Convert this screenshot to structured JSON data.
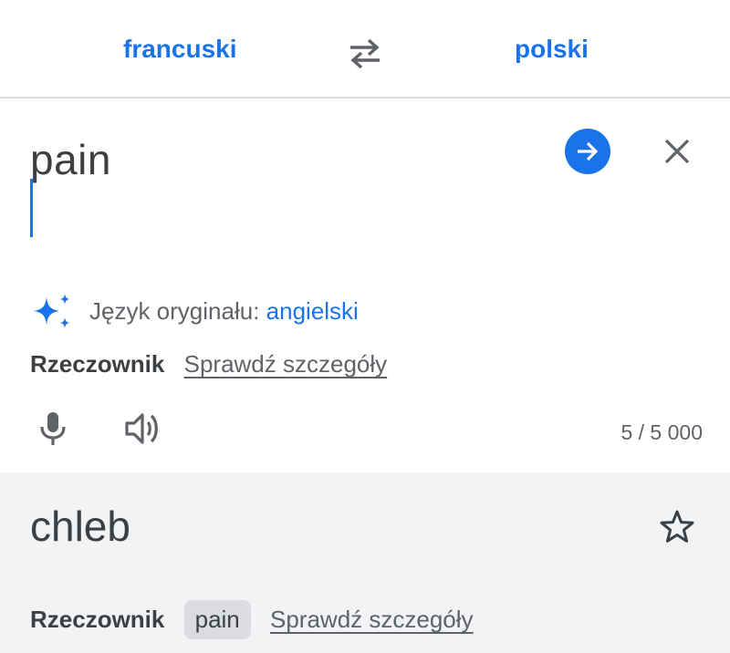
{
  "languages": {
    "source": "francuski",
    "target": "polski"
  },
  "input": {
    "query": "pain",
    "detected_prefix": "Język oryginału: ",
    "detected_lang": "angielski",
    "part_of_speech": "Rzeczownik",
    "details_link": "Sprawdź szczegóły",
    "char_count": "5 / 5 000"
  },
  "output": {
    "translation": "chleb",
    "part_of_speech": "Rzeczownik",
    "chip": "pain",
    "details_link": "Sprawdź szczegóły"
  },
  "icons": {
    "swap": "swap-arrows-icon",
    "go": "arrow-right-icon",
    "clear": "close-icon",
    "detect": "sparkle-icon",
    "mic": "microphone-icon",
    "speaker": "speaker-icon",
    "star": "star-outline-icon"
  },
  "colors": {
    "accent": "#1a73e8",
    "output_bg": "#f1f3f4"
  }
}
